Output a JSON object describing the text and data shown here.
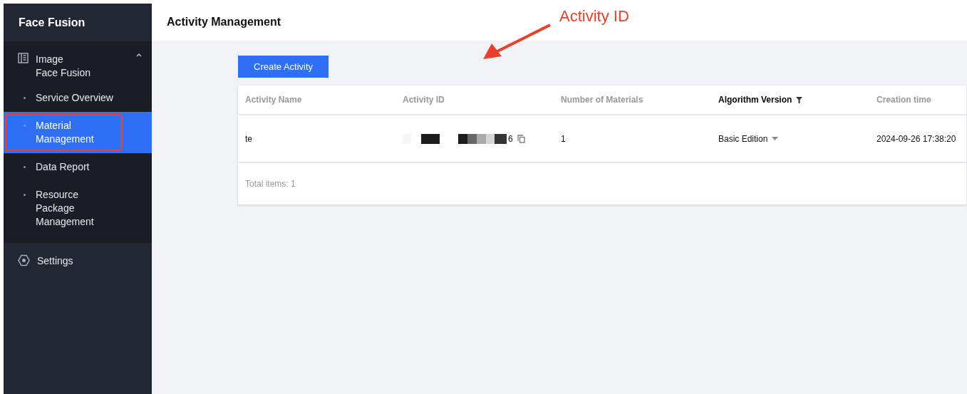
{
  "sidebar": {
    "title": "Face Fusion",
    "groups": [
      {
        "label_lines": [
          "Image",
          "Face Fusion"
        ],
        "expanded": true,
        "children": [
          {
            "label_lines": [
              "Service Overview"
            ],
            "selected": false,
            "annotated": false
          },
          {
            "label_lines": [
              "Material",
              "Management"
            ],
            "selected": true,
            "annotated": true
          },
          {
            "label_lines": [
              "Data Report"
            ],
            "selected": false,
            "annotated": false
          },
          {
            "label_lines": [
              "Resource",
              "Package",
              "Management"
            ],
            "selected": false,
            "annotated": false
          }
        ]
      },
      {
        "label_lines": [
          "Settings"
        ],
        "expanded": false
      }
    ]
  },
  "page_title": "Activity Management",
  "create_button": "Create Activity",
  "annotation": {
    "label": "Activity ID"
  },
  "table": {
    "columns": [
      {
        "label": "Activity Name",
        "filter": false,
        "active": false
      },
      {
        "label": "Activity ID",
        "filter": false,
        "active": false
      },
      {
        "label": "Number of Materials",
        "filter": false,
        "active": false
      },
      {
        "label": "Algorithm Version",
        "filter": true,
        "active": true
      },
      {
        "label": "Creation time",
        "filter": false,
        "active": false
      }
    ],
    "rows": [
      {
        "activity_name": "te",
        "activity_id": "6",
        "materials": "1",
        "algorithm_version": "Basic Edition",
        "creation_time": "2024-09-26 17:38:20"
      }
    ],
    "total": "Total items:  1"
  }
}
